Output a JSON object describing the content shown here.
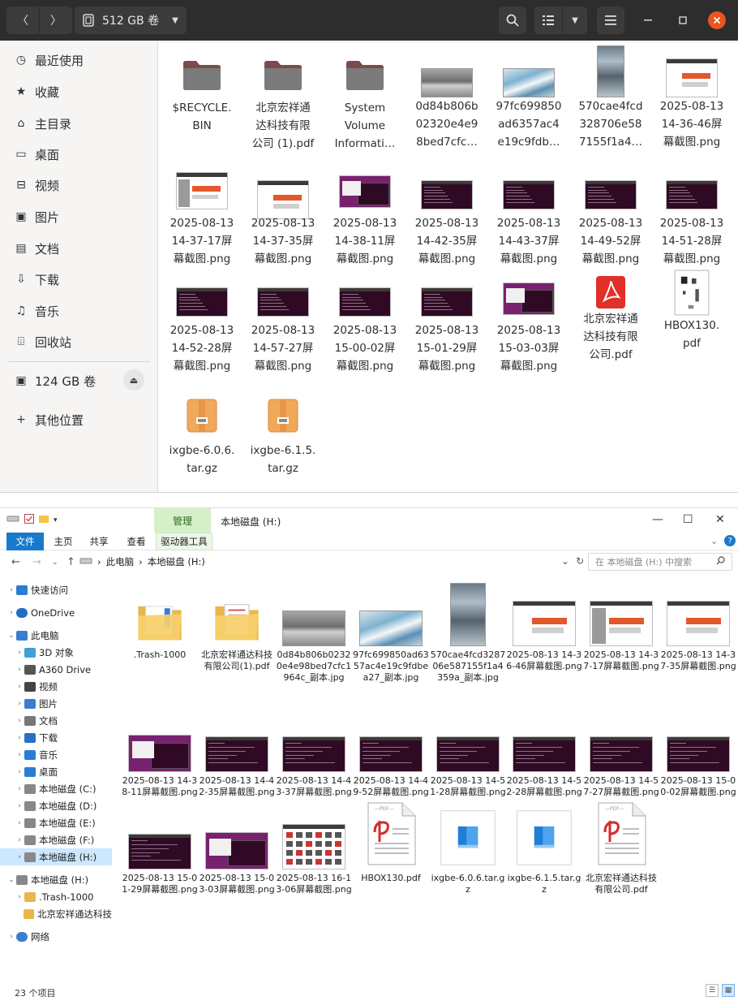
{
  "nautilus": {
    "location": "512 GB 卷",
    "sidebar": [
      {
        "label": "最近使用",
        "icon": "clock-icon"
      },
      {
        "label": "收藏",
        "icon": "star-icon"
      },
      {
        "label": "主目录",
        "icon": "home-icon"
      },
      {
        "label": "桌面",
        "icon": "desktop-icon"
      },
      {
        "label": "视频",
        "icon": "video-icon"
      },
      {
        "label": "图片",
        "icon": "picture-icon"
      },
      {
        "label": "文档",
        "icon": "document-icon"
      },
      {
        "label": "下载",
        "icon": "download-icon"
      },
      {
        "label": "音乐",
        "icon": "music-icon"
      },
      {
        "label": "回收站",
        "icon": "trash-icon"
      },
      {
        "label": "124 GB 卷",
        "icon": "drive-icon"
      },
      {
        "label": "其他位置",
        "icon": "plus-icon"
      }
    ],
    "files": [
      {
        "name": "$RECYCLE.\nBIN",
        "kind": "folder"
      },
      {
        "name": "北京宏祥通\n达科技有限\n公司 (1).pdf",
        "kind": "folder"
      },
      {
        "name": "System\nVolume\nInformati…",
        "kind": "folder"
      },
      {
        "name": "0d84b806b\n02320e4e9\n8bed7cfc…",
        "kind": "photo"
      },
      {
        "name": "97fc699850\nad6357ac4\ne19c9fdb…",
        "kind": "photo2"
      },
      {
        "name": "570cae4fcd\n328706e58\n7155f1a4…",
        "kind": "photo3"
      },
      {
        "name": "2025-08-13\n14-36-46屏\n幕截图.png",
        "kind": "doc"
      },
      {
        "name": "2025-08-13\n14-37-17屏\n幕截图.png",
        "kind": "doc2"
      },
      {
        "name": "2025-08-13\n14-37-35屏\n幕截图.png",
        "kind": "doc"
      },
      {
        "name": "2025-08-13\n14-38-11屏\n幕截图.png",
        "kind": "desk"
      },
      {
        "name": "2025-08-13\n14-42-35屏\n幕截图.png",
        "kind": "term"
      },
      {
        "name": "2025-08-13\n14-43-37屏\n幕截图.png",
        "kind": "term"
      },
      {
        "name": "2025-08-13\n14-49-52屏\n幕截图.png",
        "kind": "term"
      },
      {
        "name": "2025-08-13\n14-51-28屏\n幕截图.png",
        "kind": "term"
      },
      {
        "name": "2025-08-13\n14-52-28屏\n幕截图.png",
        "kind": "term"
      },
      {
        "name": "2025-08-13\n14-57-27屏\n幕截图.png",
        "kind": "term"
      },
      {
        "name": "2025-08-13\n15-00-02屏\n幕截图.png",
        "kind": "term"
      },
      {
        "name": "2025-08-13\n15-01-29屏\n幕截图.png",
        "kind": "term"
      },
      {
        "name": "2025-08-13\n15-03-03屏\n幕截图.png",
        "kind": "desk"
      },
      {
        "name": "北京宏祥通\n达科技有限\n公司.pdf",
        "kind": "pdf"
      },
      {
        "name": "HBOX130.\npdf",
        "kind": "pdfdoc"
      },
      {
        "name": "ixgbe-6.0.6.\ntar.gz",
        "kind": "archive"
      },
      {
        "name": "ixgbe-6.1.5.\ntar.gz",
        "kind": "archive"
      }
    ]
  },
  "explorer": {
    "title": "本地磁盘 (H:)",
    "manage_tab": "管理",
    "tabs": {
      "file": "文件",
      "home": "主页",
      "share": "共享",
      "view": "查看",
      "drive": "驱动器工具"
    },
    "breadcrumb": [
      "此电脑",
      "本地磁盘 (H:)"
    ],
    "search_placeholder": "在 本地磁盘 (H:) 中搜索",
    "nav": [
      {
        "label": "快速访问",
        "level": 0,
        "exp": "›",
        "icon": "star"
      },
      {
        "label": "OneDrive",
        "level": 0,
        "exp": "›",
        "icon": "cloud"
      },
      {
        "label": "此电脑",
        "level": 0,
        "exp": "⌄",
        "icon": "pc"
      },
      {
        "label": "3D 对象",
        "level": 1,
        "exp": "›",
        "icon": "cube"
      },
      {
        "label": "A360 Drive",
        "level": 1,
        "exp": "›",
        "icon": "a360"
      },
      {
        "label": "视频",
        "level": 1,
        "exp": "›",
        "icon": "video"
      },
      {
        "label": "图片",
        "level": 1,
        "exp": "›",
        "icon": "pic"
      },
      {
        "label": "文档",
        "level": 1,
        "exp": "›",
        "icon": "doc"
      },
      {
        "label": "下载",
        "level": 1,
        "exp": "›",
        "icon": "down"
      },
      {
        "label": "音乐",
        "level": 1,
        "exp": "›",
        "icon": "music"
      },
      {
        "label": "桌面",
        "level": 1,
        "exp": "›",
        "icon": "desk"
      },
      {
        "label": "本地磁盘 (C:)",
        "level": 1,
        "exp": "›",
        "icon": "drive"
      },
      {
        "label": "本地磁盘 (D:)",
        "level": 1,
        "exp": "›",
        "icon": "drive"
      },
      {
        "label": "本地磁盘 (E:)",
        "level": 1,
        "exp": "›",
        "icon": "drive"
      },
      {
        "label": "本地磁盘 (F:)",
        "level": 1,
        "exp": "›",
        "icon": "drive"
      },
      {
        "label": "本地磁盘 (H:)",
        "level": 1,
        "exp": "›",
        "icon": "drive",
        "selected": true
      },
      {
        "label": "本地磁盘 (H:)",
        "level": 0,
        "exp": "⌄",
        "icon": "drive"
      },
      {
        "label": ".Trash-1000",
        "level": 1,
        "exp": "›",
        "icon": "folder"
      },
      {
        "label": "北京宏祥通达科技",
        "level": 1,
        "exp": "",
        "icon": "folder"
      },
      {
        "label": "网络",
        "level": 0,
        "exp": "›",
        "icon": "net"
      }
    ],
    "files": [
      {
        "name": ".Trash-1000",
        "kind": "folder"
      },
      {
        "name": "北京宏祥通达科技有限公司(1).pdf",
        "kind": "folderdoc"
      },
      {
        "name": "0d84b806b02320e4e98bed7cfc1964c_副本.jpg",
        "kind": "photo"
      },
      {
        "name": "97fc699850ad6357ac4e19c9fdbea27_副本.jpg",
        "kind": "photo2"
      },
      {
        "name": "570cae4fcd328706e587155f1a4359a_副本.jpg",
        "kind": "photo3"
      },
      {
        "name": "2025-08-13 14-36-46屏幕截图.png",
        "kind": "doc"
      },
      {
        "name": "2025-08-13 14-37-17屏幕截图.png",
        "kind": "doc2"
      },
      {
        "name": "2025-08-13 14-37-35屏幕截图.png",
        "kind": "doc"
      },
      {
        "name": "2025-08-13 14-38-11屏幕截图.png",
        "kind": "desk"
      },
      {
        "name": "2025-08-13 14-42-35屏幕截图.png",
        "kind": "term"
      },
      {
        "name": "2025-08-13 14-43-37屏幕截图.png",
        "kind": "term"
      },
      {
        "name": "2025-08-13 14-49-52屏幕截图.png",
        "kind": "term"
      },
      {
        "name": "2025-08-13 14-51-28屏幕截图.png",
        "kind": "term"
      },
      {
        "name": "2025-08-13 14-52-28屏幕截图.png",
        "kind": "term"
      },
      {
        "name": "2025-08-13 14-57-27屏幕截图.png",
        "kind": "term"
      },
      {
        "name": "2025-08-13 15-00-02屏幕截图.png",
        "kind": "term"
      },
      {
        "name": "2025-08-13 15-01-29屏幕截图.png",
        "kind": "term"
      },
      {
        "name": "2025-08-13 15-03-03屏幕截图.png",
        "kind": "desk"
      },
      {
        "name": "2025-08-13 16-13-06屏幕截图.png",
        "kind": "grid"
      },
      {
        "name": "HBOX130.pdf",
        "kind": "pdfpage"
      },
      {
        "name": "ixgbe-6.0.6.tar.gz",
        "kind": "gz"
      },
      {
        "name": "ixgbe-6.1.5.tar.gz",
        "kind": "gz"
      },
      {
        "name": "北京宏祥通达科技有限公司.pdf",
        "kind": "pdfpage"
      }
    ],
    "status": "23 个项目"
  }
}
